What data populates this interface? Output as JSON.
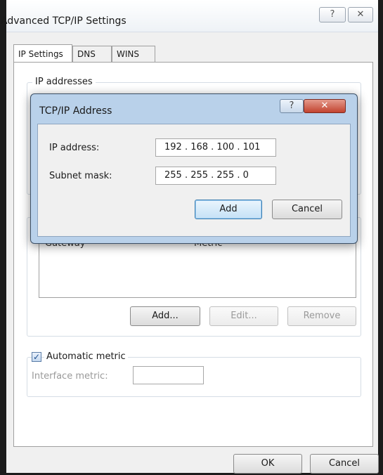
{
  "window": {
    "title": "Advanced TCP/IP Settings",
    "help_glyph": "?",
    "close_glyph": "✕"
  },
  "tabs": [
    {
      "label": "IP Settings",
      "active": true
    },
    {
      "label": "DNS",
      "active": false
    },
    {
      "label": "WINS",
      "active": false
    }
  ],
  "ip_addresses": {
    "label": "IP addresses"
  },
  "gateways": {
    "columns": [
      "Gateway",
      "Metric"
    ],
    "add_label": "Add...",
    "edit_label": "Edit...",
    "remove_label": "Remove"
  },
  "metric": {
    "auto_label": "Automatic metric",
    "auto_checked": true,
    "check_glyph": "✓",
    "interface_label": "Interface metric:",
    "interface_value": ""
  },
  "footer": {
    "ok_label": "OK",
    "cancel_label": "Cancel"
  },
  "dialog": {
    "title": "TCP/IP Address",
    "help_glyph": "?",
    "close_glyph": "✕",
    "ip_label": "IP address:",
    "ip_value": "192 . 168 . 100 . 101",
    "mask_label": "Subnet mask:",
    "mask_value": "255 . 255 . 255 . 0",
    "add_label": "Add",
    "cancel_label": "Cancel"
  }
}
